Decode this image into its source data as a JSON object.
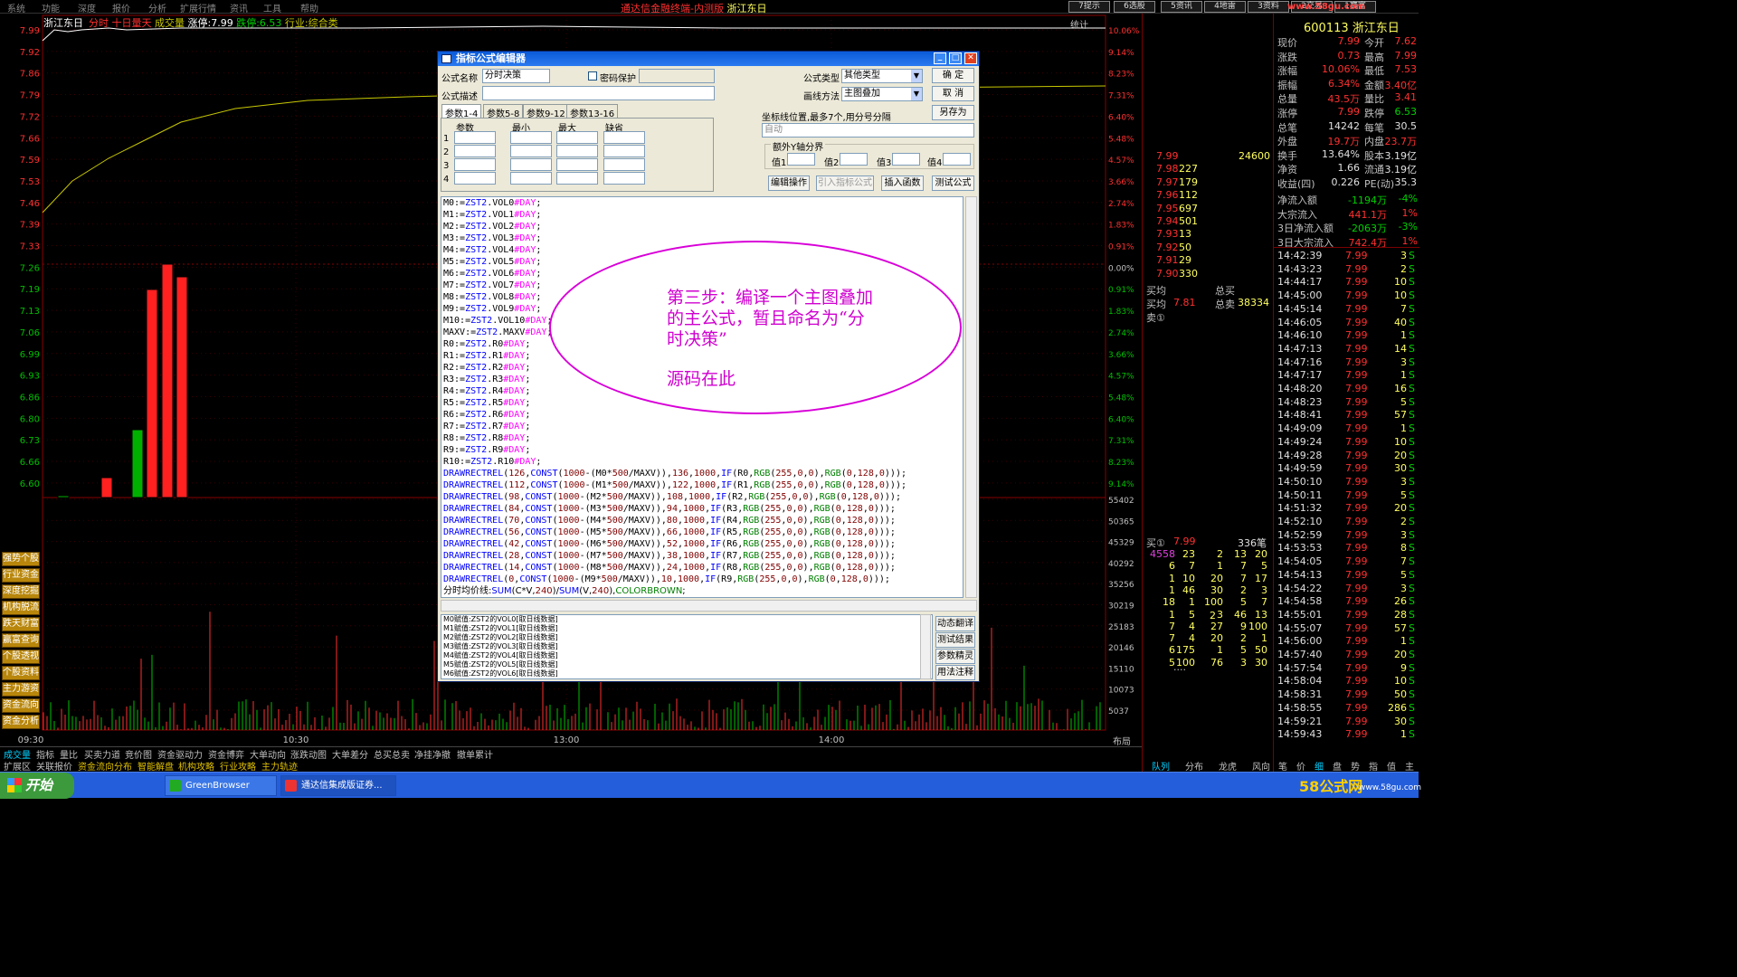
{
  "menu": [
    "系统",
    "功能",
    "深度",
    "报价",
    "分析",
    "扩展行情",
    "资讯",
    "工具",
    "帮助"
  ],
  "app_title": "通达信金融终端-内测版",
  "window_stock": "浙江东日",
  "top_buttons": [
    "7提示",
    "6选股",
    "5资讯",
    "4地雷",
    "3资料",
    "2交易",
    "1寶富"
  ],
  "watermark": "www.58gu.com",
  "chart": {
    "stock_name": "浙江东日",
    "header_labels": [
      "分时",
      "十日量天",
      "成交量"
    ],
    "limit_up_label": "涨停:7.99",
    "limit_down_label": "跌停:6.53",
    "industry_label": "行业:综合类",
    "price_ticks": [
      "7.99",
      "7.92",
      "7.86",
      "7.79",
      "7.72",
      "7.66",
      "7.59",
      "7.53",
      "7.46",
      "7.39",
      "7.33",
      "7.26",
      "7.19",
      "7.13",
      "7.06",
      "6.99",
      "6.93",
      "6.86",
      "6.80",
      "6.73",
      "6.66",
      "6.60"
    ],
    "pct_ticks": [
      "10.06%",
      "9.14%",
      "8.23%",
      "7.31%",
      "6.40%",
      "5.48%",
      "4.57%",
      "3.66%",
      "2.74%",
      "1.83%",
      "0.91%",
      "0.00%",
      "0.91%",
      "1.83%",
      "2.74%",
      "3.66%",
      "4.57%",
      "5.48%",
      "6.40%",
      "7.31%",
      "8.23%",
      "9.14%"
    ],
    "vol_ticks": [
      "55402",
      "50365",
      "45329",
      "40292",
      "35256",
      "30219",
      "25183",
      "20146",
      "15110",
      "10073",
      "5037"
    ],
    "time_ticks": [
      "09:30",
      "10:30",
      "13:00",
      "14:00"
    ],
    "stats_label": "统计",
    "layout_label": "布局",
    "colors": {
      "up": "#ff2020",
      "down": "#00b000",
      "price": "#ffffff",
      "avg": "#c8c800"
    }
  },
  "left_tabs": [
    "强势个股",
    "行业资金",
    "深度挖掘",
    "机构脱流",
    "跌天财富",
    "赢富查询",
    "个股透视",
    "个股资料",
    "主力游资",
    "资金流向",
    "资金分析"
  ],
  "bottom_tabs1": [
    "成交量",
    "指标",
    "量比",
    "买卖力道",
    "竞价图",
    "资金驱动力",
    "资金博弈",
    "大单动向",
    "涨跌动图",
    "大单差分",
    "总买总卖",
    "净挂净撤",
    "撤单累计"
  ],
  "bottom_tabs2": [
    "扩展区",
    "关联报价",
    "资金流向分布",
    "智能解盘",
    "机构攻略",
    "行业攻略",
    "主力轨迹"
  ],
  "right_tabs": [
    "队列",
    "分布",
    "龙虎",
    "风向"
  ],
  "right_small_tabs": [
    "笔",
    "价",
    "细",
    "盘",
    "势",
    "指",
    "值",
    "主"
  ],
  "quote": {
    "code_name": "600113 浙江东日",
    "rows": [
      [
        "现价",
        "7.99",
        "今开",
        "7.62"
      ],
      [
        "涨跌",
        "0.73",
        "最高",
        "7.99"
      ],
      [
        "涨幅",
        "10.06%",
        "最低",
        "7.53"
      ],
      [
        "振幅",
        "6.34%",
        "金额",
        "3.40亿"
      ],
      [
        "总量",
        "43.5万",
        "量比",
        "3.41"
      ],
      [
        "涨停",
        "7.99",
        "跌停",
        "6.53"
      ],
      [
        "总笔",
        "14242",
        "每笔",
        "30.5"
      ],
      [
        "外盘",
        "19.7万",
        "内盘",
        "23.7万"
      ],
      [
        "换手",
        "13.64%",
        "股本",
        "3.19亿"
      ],
      [
        "净资",
        "1.66",
        "流通",
        "3.19亿"
      ],
      [
        "收益(四)",
        "0.226",
        "PE(动)",
        "35.3"
      ]
    ],
    "flows": [
      [
        "净流入额",
        "-1194万",
        "-4%"
      ],
      [
        "大宗流入",
        "441.1万",
        "1%"
      ],
      [
        "3日净流入额",
        "-2063万",
        "-3%"
      ],
      [
        "3日大宗流入",
        "742.4万",
        "1%"
      ]
    ],
    "order_book": [
      [
        "7.99",
        "24600"
      ],
      [
        "7.98",
        "227"
      ],
      [
        "7.97",
        "179"
      ],
      [
        "7.96",
        "112"
      ],
      [
        "7.95",
        "697"
      ],
      [
        "7.94",
        "501"
      ],
      [
        "7.93",
        "13"
      ],
      [
        "7.92",
        "50"
      ],
      [
        "7.91",
        "29"
      ],
      [
        "7.90",
        "330"
      ]
    ],
    "avg_buy_label": "买均",
    "avg_buy": "7.81",
    "total_buy_label": "总买",
    "total_buy": "38334",
    "avg_sell_label": "卖均",
    "total_sell_label": "总卖",
    "sell_marker": "卖①",
    "queue_label": "买①",
    "queue_price": "7.99",
    "queue_count": "336笔",
    "queue_rows": [
      [
        "4558",
        "23",
        "2",
        "13",
        "20"
      ],
      [
        "6",
        "7",
        "1",
        "7",
        "5"
      ],
      [
        "1",
        "10",
        "20",
        "7",
        "17"
      ],
      [
        "1",
        "46",
        "30",
        "2",
        "3"
      ],
      [
        "18",
        "1",
        "100",
        "5",
        "7"
      ],
      [
        "1",
        "5",
        "3",
        "46",
        "13"
      ],
      [
        "7",
        "4",
        "27",
        "9",
        "100"
      ],
      [
        "7",
        "4",
        "20",
        "2",
        "1"
      ],
      [
        "6",
        "175",
        "1",
        "5",
        "50"
      ],
      [
        "5",
        "100",
        "76",
        "3",
        "30"
      ]
    ],
    "queue_extra_row": "2",
    "queue_more": "....",
    "ticks": [
      [
        "14:42:39",
        "7.99",
        "3",
        "S"
      ],
      [
        "14:43:23",
        "7.99",
        "2",
        "S"
      ],
      [
        "14:44:17",
        "7.99",
        "10",
        "S"
      ],
      [
        "14:45:00",
        "7.99",
        "10",
        "S"
      ],
      [
        "14:45:14",
        "7.99",
        "7",
        "S"
      ],
      [
        "14:46:05",
        "7.99",
        "40",
        "S"
      ],
      [
        "14:46:10",
        "7.99",
        "1",
        "S"
      ],
      [
        "14:47:13",
        "7.99",
        "14",
        "S"
      ],
      [
        "14:47:16",
        "7.99",
        "3",
        "S"
      ],
      [
        "14:47:17",
        "7.99",
        "1",
        "S"
      ],
      [
        "14:48:20",
        "7.99",
        "16",
        "S"
      ],
      [
        "14:48:23",
        "7.99",
        "5",
        "S"
      ],
      [
        "14:48:41",
        "7.99",
        "57",
        "S"
      ],
      [
        "14:49:09",
        "7.99",
        "1",
        "S"
      ],
      [
        "14:49:24",
        "7.99",
        "10",
        "S"
      ],
      [
        "14:49:28",
        "7.99",
        "20",
        "S"
      ],
      [
        "14:49:59",
        "7.99",
        "30",
        "S"
      ],
      [
        "14:50:10",
        "7.99",
        "3",
        "S"
      ],
      [
        "14:50:11",
        "7.99",
        "5",
        "S"
      ],
      [
        "14:51:32",
        "7.99",
        "20",
        "S"
      ],
      [
        "14:52:10",
        "7.99",
        "2",
        "S"
      ],
      [
        "14:52:59",
        "7.99",
        "3",
        "S"
      ],
      [
        "14:53:53",
        "7.99",
        "8",
        "S"
      ],
      [
        "14:54:05",
        "7.99",
        "7",
        "S"
      ],
      [
        "14:54:13",
        "7.99",
        "5",
        "S"
      ],
      [
        "14:54:22",
        "7.99",
        "3",
        "S"
      ],
      [
        "14:54:58",
        "7.99",
        "26",
        "S"
      ],
      [
        "14:55:01",
        "7.99",
        "28",
        "S"
      ],
      [
        "14:55:07",
        "7.99",
        "57",
        "S"
      ],
      [
        "14:56:00",
        "7.99",
        "1",
        "S"
      ],
      [
        "14:57:40",
        "7.99",
        "20",
        "S"
      ],
      [
        "14:57:54",
        "7.99",
        "9",
        "S"
      ],
      [
        "14:58:04",
        "7.99",
        "10",
        "S"
      ],
      [
        "14:58:31",
        "7.99",
        "50",
        "S"
      ],
      [
        "14:58:55",
        "7.99",
        "286",
        "S"
      ],
      [
        "14:59:21",
        "7.99",
        "30",
        "S"
      ],
      [
        "14:59:43",
        "7.99",
        "1",
        "S"
      ]
    ]
  },
  "dialog": {
    "title": "指标公式编辑器",
    "name_label": "公式名称",
    "name_value": "分时决策",
    "password_label": "密码保护",
    "desc_label": "公式描述",
    "type_label": "公式类型",
    "type_value": "其他类型",
    "draw_label": "画线方法",
    "draw_value": "主图叠加",
    "ok": "确  定",
    "cancel": "取  消",
    "save_as": "另存为",
    "param_tabs": [
      "参数1-4",
      "参数5-8",
      "参数9-12",
      "参数13-16"
    ],
    "param_headers": [
      "参数",
      "最小",
      "最大",
      "缺省"
    ],
    "param_rows": [
      "1",
      "2",
      "3",
      "4"
    ],
    "coord_label": "坐标线位置,最多7个,用分号分隔",
    "coord_value": "自动",
    "yaxis_label": "额外Y轴分界",
    "value_labels": [
      "值1",
      "值2",
      "值3",
      "值4"
    ],
    "buttons": [
      "编辑操作",
      "引入指标公式",
      "插入函数",
      "测试公式"
    ],
    "side_buttons": [
      "动态翻译",
      "测试结果",
      "参数精灵",
      "用法注释"
    ],
    "messages": [
      "M0赋值:ZST2的VOL0[取日线数据]",
      "M1赋值:ZST2的VOL1[取日线数据]",
      "M2赋值:ZST2的VOL2[取日线数据]",
      "M3赋值:ZST2的VOL3[取日线数据]",
      "M4赋值:ZST2的VOL4[取日线数据]",
      "M5赋值:ZST2的VOL5[取日线数据]",
      "M6赋值:ZST2的VOL6[取日线数据]"
    ]
  },
  "code_lines": [
    "M0:=ZST2.VOL0#DAY;",
    "M1:=ZST2.VOL1#DAY;",
    "M2:=ZST2.VOL2#DAY;",
    "M3:=ZST2.VOL3#DAY;",
    "M4:=ZST2.VOL4#DAY;",
    "M5:=ZST2.VOL5#DAY;",
    "M6:=ZST2.VOL6#DAY;",
    "M7:=ZST2.VOL7#DAY;",
    "M8:=ZST2.VOL8#DAY;",
    "M9:=ZST2.VOL9#DAY;",
    "M10:=ZST2.VOL10#DAY;",
    "MAXV:=ZST2.MAXV#DAY;",
    "R0:=ZST2.R0#DAY;",
    "R1:=ZST2.R1#DAY;",
    "R2:=ZST2.R2#DAY;",
    "R3:=ZST2.R3#DAY;",
    "R4:=ZST2.R4#DAY;",
    "R5:=ZST2.R5#DAY;",
    "R6:=ZST2.R6#DAY;",
    "R7:=ZST2.R7#DAY;",
    "R8:=ZST2.R8#DAY;",
    "R9:=ZST2.R9#DAY;",
    "R10:=ZST2.R10#DAY;",
    "DRAWRECTREL(126,CONST(1000-(M0*500/MAXV)),136,1000,IF(R0,RGB(255,0,0),RGB(0,128,0)));",
    "DRAWRECTREL(112,CONST(1000-(M1*500/MAXV)),122,1000,IF(R1,RGB(255,0,0),RGB(0,128,0)));",
    "DRAWRECTREL(98,CONST(1000-(M2*500/MAXV)),108,1000,IF(R2,RGB(255,0,0),RGB(0,128,0)));",
    "DRAWRECTREL(84,CONST(1000-(M3*500/MAXV)),94,1000,IF(R3,RGB(255,0,0),RGB(0,128,0)));",
    "DRAWRECTREL(70,CONST(1000-(M4*500/MAXV)),80,1000,IF(R4,RGB(255,0,0),RGB(0,128,0)));",
    "DRAWRECTREL(56,CONST(1000-(M5*500/MAXV)),66,1000,IF(R5,RGB(255,0,0),RGB(0,128,0)));",
    "DRAWRECTREL(42,CONST(1000-(M6*500/MAXV)),52,1000,IF(R6,RGB(255,0,0),RGB(0,128,0)));",
    "DRAWRECTREL(28,CONST(1000-(M7*500/MAXV)),38,1000,IF(R7,RGB(255,0,0),RGB(0,128,0)));",
    "DRAWRECTREL(14,CONST(1000-(M8*500/MAXV)),24,1000,IF(R8,RGB(255,0,0),RGB(0,128,0)));",
    "DRAWRECTREL(0,CONST(1000-(M9*500/MAXV)),10,1000,IF(R9,RGB(255,0,0),RGB(0,128,0)));",
    "分时均价线:SUM(C*V,240)/SUM(V,240),COLORBROWN;"
  ],
  "annotation": {
    "line1": "第三步：编译一个主图叠加",
    "line2": "的主公式，暂且命名为“分",
    "line3": "时决策”",
    "line4": "源码在此"
  },
  "taskbar": {
    "start": "开始",
    "tasks": [
      "GreenBrowser",
      "通达信集成版证券..."
    ],
    "logo": "58公式网",
    "logo_url": "www.58gu.com"
  }
}
